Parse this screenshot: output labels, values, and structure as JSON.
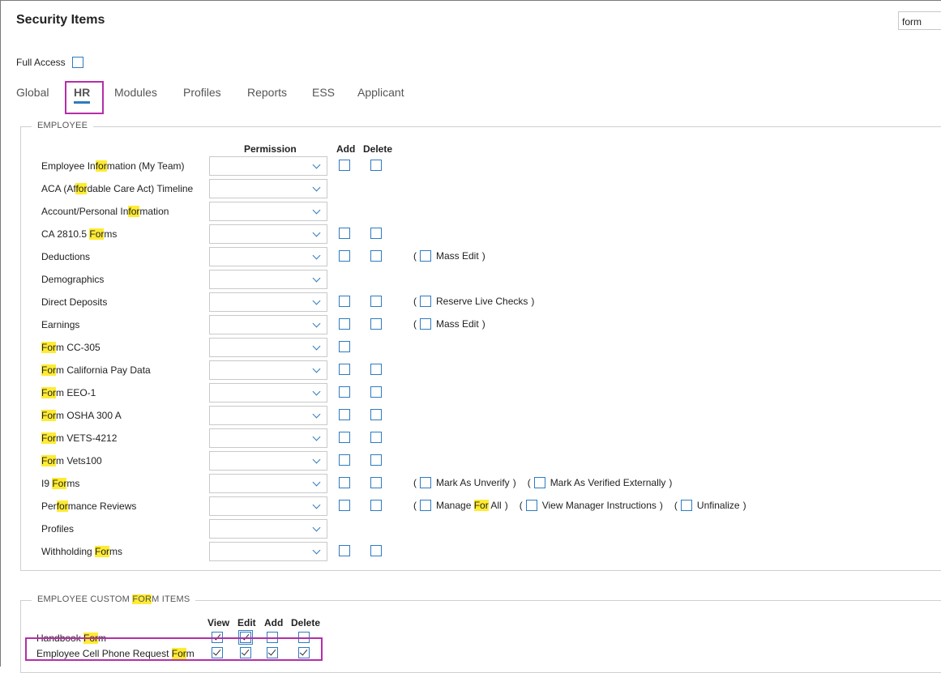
{
  "page": {
    "title": "Security Items",
    "search_value": "form",
    "full_access_label": "Full Access"
  },
  "tabs": [
    {
      "label": "Global"
    },
    {
      "label": "HR",
      "active": true
    },
    {
      "label": "Modules"
    },
    {
      "label": "Profiles"
    },
    {
      "label": "Reports"
    },
    {
      "label": "ESS"
    },
    {
      "label": "Applicant"
    }
  ],
  "employee": {
    "legend": "EMPLOYEE",
    "headers": {
      "permission": "Permission",
      "add": "Add",
      "delete": "Delete"
    },
    "rows": [
      {
        "label": "Employee Information (My Team)",
        "highlight": "for",
        "add": true,
        "delete": true,
        "extras": []
      },
      {
        "label": "ACA (Affordable Care Act) Timeline",
        "highlight": "for",
        "add": false,
        "delete": false,
        "extras": []
      },
      {
        "label": "Account/Personal Information",
        "highlight": "for",
        "add": false,
        "delete": false,
        "extras": []
      },
      {
        "label": "CA 2810.5 Forms",
        "highlight": "For",
        "add": true,
        "delete": true,
        "extras": []
      },
      {
        "label": "Deductions",
        "highlight": "",
        "add": true,
        "delete": true,
        "extras": [
          "Mass Edit"
        ]
      },
      {
        "label": "Demographics",
        "highlight": "",
        "add": false,
        "delete": false,
        "extras": []
      },
      {
        "label": "Direct Deposits",
        "highlight": "",
        "add": true,
        "delete": true,
        "extras": [
          "Reserve Live Checks"
        ]
      },
      {
        "label": "Earnings",
        "highlight": "",
        "add": true,
        "delete": true,
        "extras": [
          "Mass Edit"
        ]
      },
      {
        "label": "Form CC-305",
        "highlight": "For",
        "add": true,
        "delete": false,
        "extras": []
      },
      {
        "label": "Form California Pay Data",
        "highlight": "For",
        "add": true,
        "delete": true,
        "extras": []
      },
      {
        "label": "Form EEO-1",
        "highlight": "For",
        "add": true,
        "delete": true,
        "extras": []
      },
      {
        "label": "Form OSHA 300 A",
        "highlight": "For",
        "add": true,
        "delete": true,
        "extras": []
      },
      {
        "label": "Form VETS-4212",
        "highlight": "For",
        "add": true,
        "delete": true,
        "extras": []
      },
      {
        "label": "Form Vets100",
        "highlight": "For",
        "add": true,
        "delete": true,
        "extras": []
      },
      {
        "label": "I9 Forms",
        "highlight": "For",
        "add": true,
        "delete": true,
        "extras": [
          "Mark As Unverify",
          "Mark As Verified Externally"
        ]
      },
      {
        "label": "Performance Reviews",
        "highlight": "for",
        "add": true,
        "delete": true,
        "extras": [
          "Manage For All",
          "View Manager Instructions",
          "Unfinalize"
        ]
      },
      {
        "label": "Profiles",
        "highlight": "",
        "add": false,
        "delete": false,
        "extras": []
      },
      {
        "label": "Withholding Forms",
        "highlight": "For",
        "add": true,
        "delete": true,
        "extras": []
      }
    ]
  },
  "custom": {
    "legend": "EMPLOYEE CUSTOM FORM ITEMS",
    "legend_highlight": "FOR",
    "headers": {
      "view": "View",
      "edit": "Edit",
      "add": "Add",
      "delete": "Delete"
    },
    "rows": [
      {
        "label": "Handbook Form",
        "highlight": "For",
        "view": true,
        "edit": true,
        "add": false,
        "delete": false
      },
      {
        "label": "Employee Cell Phone Request Form",
        "highlight": "For",
        "view": true,
        "edit": true,
        "add": true,
        "delete": true
      }
    ]
  },
  "colors": {
    "accent": "#2f7bbf",
    "highlight": "#ffeb33",
    "annotation": "#b62ea8"
  }
}
